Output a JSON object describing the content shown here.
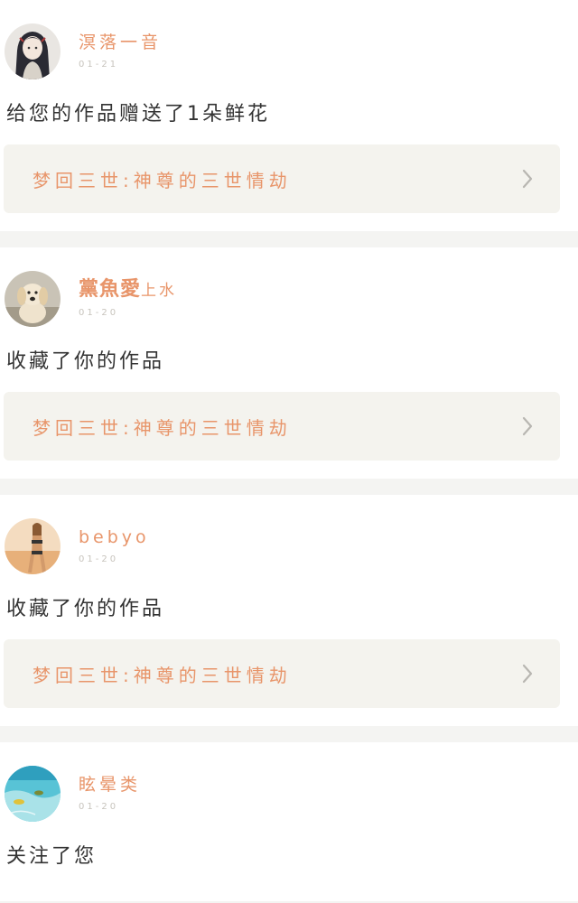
{
  "notifications": [
    {
      "username": "溟落一音",
      "username_bold": "",
      "username_suffix": "",
      "date": "01-21",
      "action": "给您的作品赠送了1朵鲜花",
      "work_title": "梦回三世:神尊的三世情劫",
      "avatar_icon": "anime-girl-avatar-icon"
    },
    {
      "username": "",
      "username_bold": "黨魚愛",
      "username_suffix": "上水",
      "date": "01-20",
      "action": "收藏了你的作品",
      "work_title": "梦回三世:神尊的三世情劫",
      "avatar_icon": "puppy-avatar-icon"
    },
    {
      "username": "bebyo",
      "username_bold": "",
      "username_suffix": "",
      "date": "01-20",
      "action": "收藏了你的作品",
      "work_title": "梦回三世:神尊的三世情劫",
      "avatar_icon": "beach-woman-avatar-icon"
    },
    {
      "username": "眩晕类",
      "username_bold": "",
      "username_suffix": "",
      "date": "01-20",
      "action": "关注了您",
      "work_title": "",
      "avatar_icon": "ocean-fish-avatar-icon"
    }
  ],
  "colors": {
    "accent": "#e8956a",
    "card_link_bg": "#f4f3ee",
    "page_bg": "#f4f4f2",
    "date_text": "#c8c4bd"
  }
}
